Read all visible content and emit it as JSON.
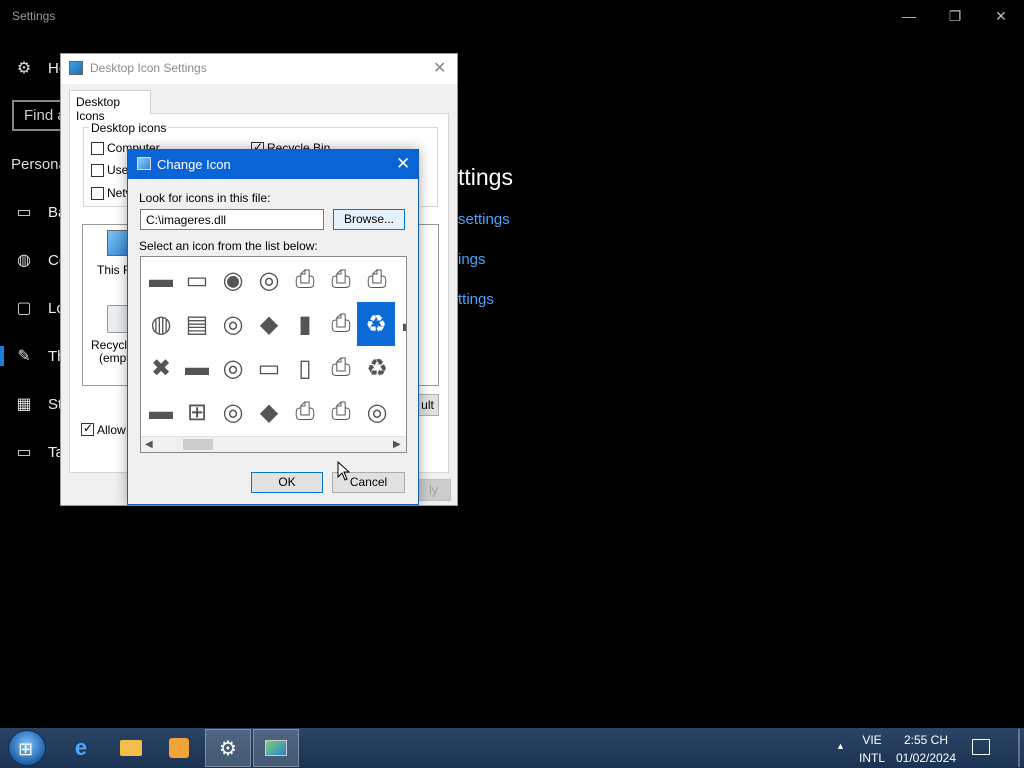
{
  "settings": {
    "title": "Settings",
    "controls": {
      "minimize": "—",
      "restore": "❐",
      "close": "✕"
    },
    "nav": {
      "home": "Ho",
      "find": "Find a",
      "section": "Persona",
      "items": [
        {
          "label": "Ba",
          "icon": "picture-icon"
        },
        {
          "label": "Co",
          "icon": "palette-icon"
        },
        {
          "label": "Lo",
          "icon": "lockscreen-icon"
        },
        {
          "label": "Th",
          "icon": "brush-icon"
        },
        {
          "label": "St",
          "icon": "start-icon"
        },
        {
          "label": "Ta",
          "icon": "taskbar-icon"
        }
      ]
    },
    "main": {
      "title": "ttings",
      "links": [
        "settings",
        "ings",
        "ttings"
      ]
    }
  },
  "desktop_icon_settings": {
    "title": "Desktop Icon Settings",
    "tab": "Desktop Icons",
    "group_label": "Desktop icons",
    "checkboxes": [
      {
        "label": "Computer",
        "checked": false
      },
      {
        "label": "User",
        "checked": false
      },
      {
        "label": "Netv",
        "checked": false
      },
      {
        "label": "Recycle Bin",
        "checked": true
      }
    ],
    "icons": [
      {
        "label": "This F"
      },
      {
        "label": "Recycle"
      },
      {
        "label": "(empt"
      }
    ],
    "allow_label": "Allow t",
    "restore_default": "ult",
    "apply": "ly"
  },
  "change_icon": {
    "title": "Change Icon",
    "look_label": "Look for icons in this file:",
    "path_value": "C:\\imageres.dll",
    "browse": "Browse...",
    "select_label": "Select an icon from the list below:",
    "ok": "OK",
    "cancel": "Cancel",
    "selected_index": 6
  },
  "taskbar": {
    "lang_top": "VIE",
    "lang_bottom": "INTL",
    "time": "2:55 CH",
    "date": "01/02/2024",
    "tray_arrow": "▲"
  }
}
